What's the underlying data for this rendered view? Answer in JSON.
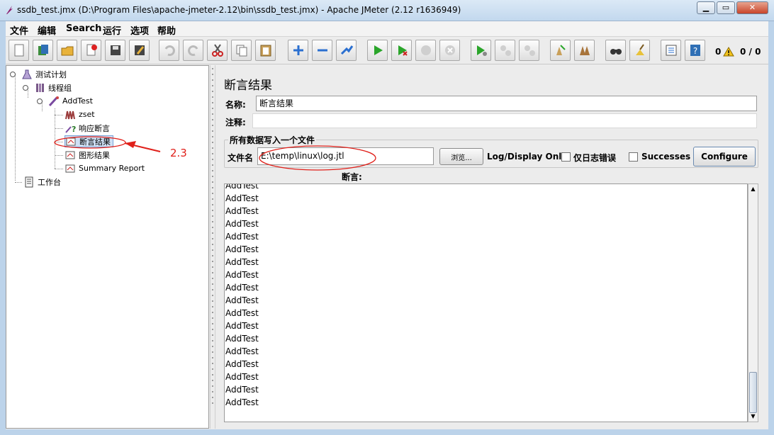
{
  "window": {
    "title": "ssdb_test.jmx (D:\\Program Files\\apache-jmeter-2.12\\bin\\ssdb_test.jmx) - Apache JMeter (2.12 r1636949)",
    "minimize": "▁",
    "maximize": "▭",
    "close": "✕"
  },
  "menu": [
    "文件",
    "编辑",
    "Search",
    "运行",
    "选项",
    "帮助"
  ],
  "toolbar": {
    "icons": [
      "new-icon",
      "templates-icon",
      "open-icon",
      "close-file-icon",
      "save-icon",
      "save-as-icon",
      "undo-icon",
      "redo-icon",
      "cut-icon",
      "copy-icon",
      "paste-icon",
      "expand-icon",
      "collapse-icon",
      "toggle-icon",
      "start-icon",
      "start-no-pause-icon",
      "stop-icon",
      "shutdown-icon",
      "remote-start-icon",
      "remote-stop-icon",
      "remote-shutdown-icon",
      "clear-icon",
      "clear-all-icon",
      "search-icon",
      "reset-search-icon",
      "function-helper-icon",
      "help-icon"
    ],
    "warning_count": "0",
    "threads": "0 / 0"
  },
  "tree": {
    "nodes": [
      {
        "label": "测试计划",
        "icon": "test-plan-icon"
      },
      {
        "label": "线程组",
        "icon": "thread-group-icon"
      },
      {
        "label": "AddTest",
        "icon": "sampler-icon"
      },
      {
        "label": "zset",
        "icon": "csv-config-icon"
      },
      {
        "label": "响应断言",
        "icon": "assertion-icon"
      },
      {
        "label": "断言结果",
        "icon": "listener-icon"
      },
      {
        "label": "图形结果",
        "icon": "listener-icon"
      },
      {
        "label": "Summary Report",
        "icon": "listener-icon"
      },
      {
        "label": "工作台",
        "icon": "workbench-icon"
      }
    ]
  },
  "annotation": {
    "label": "2.3",
    "color": "#e0201a"
  },
  "panel": {
    "title": "断言结果",
    "name_label": "名称:",
    "name_value": "断言结果",
    "comment_label": "注释:",
    "comment_value": "",
    "group_title": "所有数据写入一个文件",
    "filename_label": "文件名",
    "filename_value": "E:\\temp\\linux\\log.jtl",
    "browse_label": "浏览...",
    "log_display_label": "Log/Display Only:",
    "errors_label": "仅日志错误",
    "errors_checked": false,
    "successes_label": "Successes",
    "successes_checked": false,
    "configure_label": "Configure",
    "assertions_label": "断言:",
    "results": [
      "AddTest",
      "AddTest",
      "AddTest",
      "AddTest",
      "AddTest",
      "AddTest",
      "AddTest",
      "AddTest",
      "AddTest",
      "AddTest",
      "AddTest",
      "AddTest",
      "AddTest",
      "AddTest",
      "AddTest",
      "AddTest",
      "AddTest",
      "AddTest"
    ]
  }
}
